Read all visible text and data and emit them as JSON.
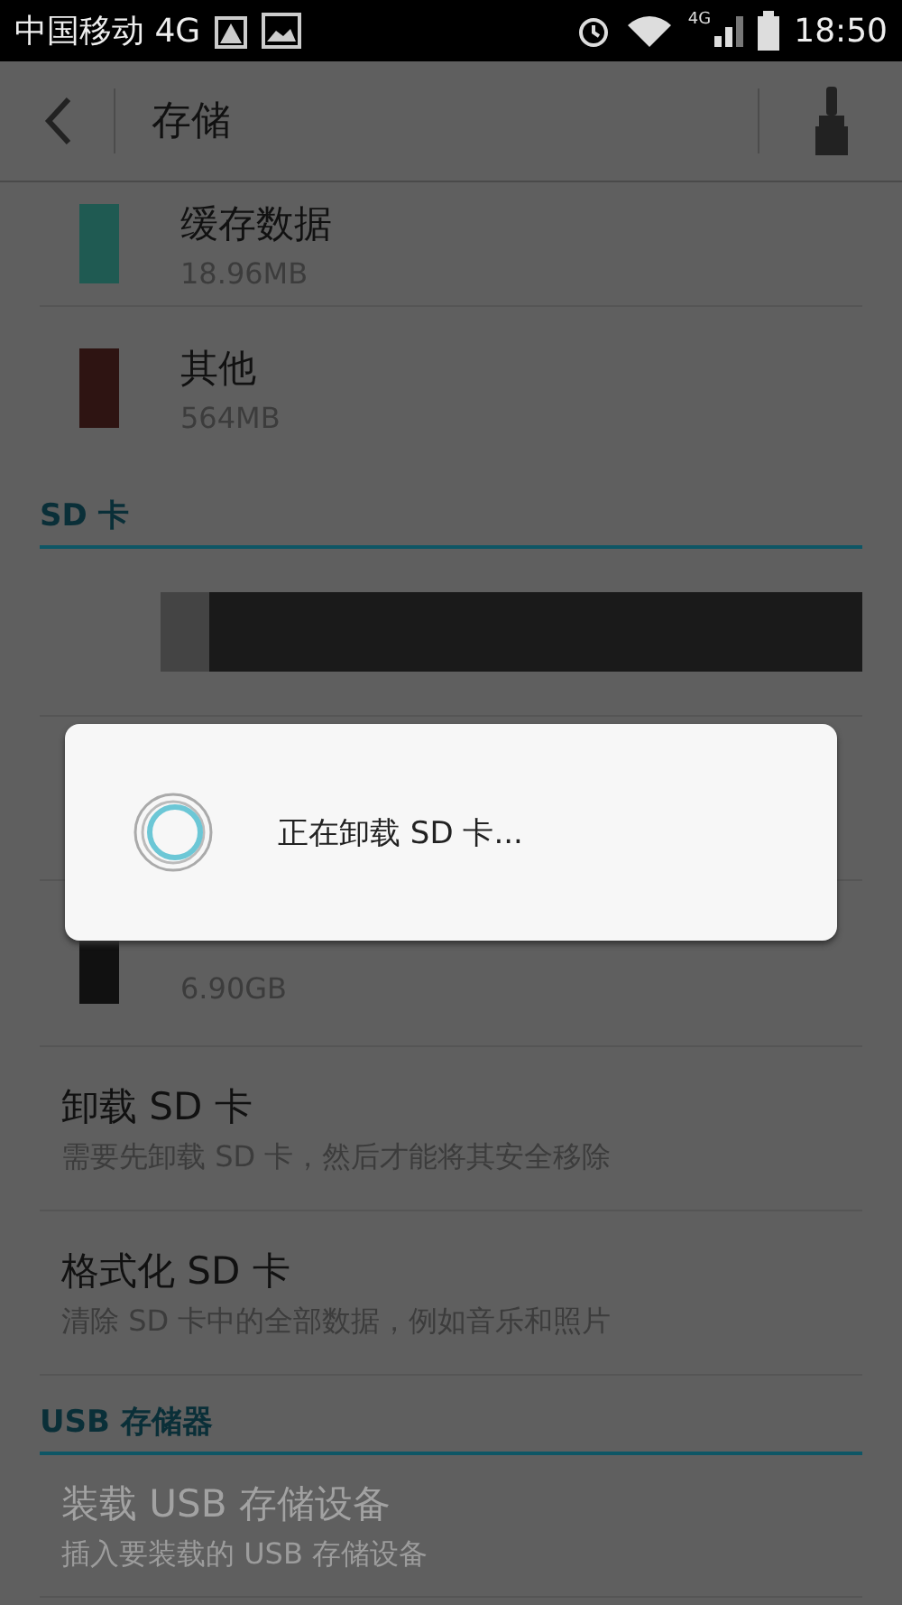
{
  "status_bar": {
    "carrier": "中国移动 4G",
    "network_badge": "4G",
    "time": "18:50"
  },
  "action_bar": {
    "title": "存储"
  },
  "sections": [
    {
      "items": [
        {
          "kind": "swatch",
          "title": "缓存数据",
          "subtitle": "18.96MB",
          "color": "#1f5a52"
        },
        {
          "kind": "swatch",
          "title": "其他",
          "subtitle": "564MB",
          "color": "#2e1412"
        }
      ]
    },
    {
      "header": "SD 卡",
      "items": [
        {
          "kind": "bar",
          "level": 0.07
        },
        {
          "kind": "hidden"
        },
        {
          "kind": "swatch",
          "subtitle": "6.90GB",
          "color": "#111111"
        },
        {
          "kind": "action",
          "title": "卸载 SD 卡",
          "subtitle": "需要先卸载 SD 卡，然后才能将其安全移除",
          "disabled": false
        },
        {
          "kind": "action",
          "title": "格式化 SD 卡",
          "subtitle": "清除 SD 卡中的全部数据，例如音乐和照片",
          "disabled": false
        }
      ]
    },
    {
      "header": "USB 存储器",
      "items": [
        {
          "kind": "action",
          "title": "装载 USB 存储设备",
          "subtitle": "插入要装载的 USB 存储设备",
          "disabled": true
        }
      ]
    }
  ],
  "dialog": {
    "message": "正在卸载 SD 卡..."
  }
}
